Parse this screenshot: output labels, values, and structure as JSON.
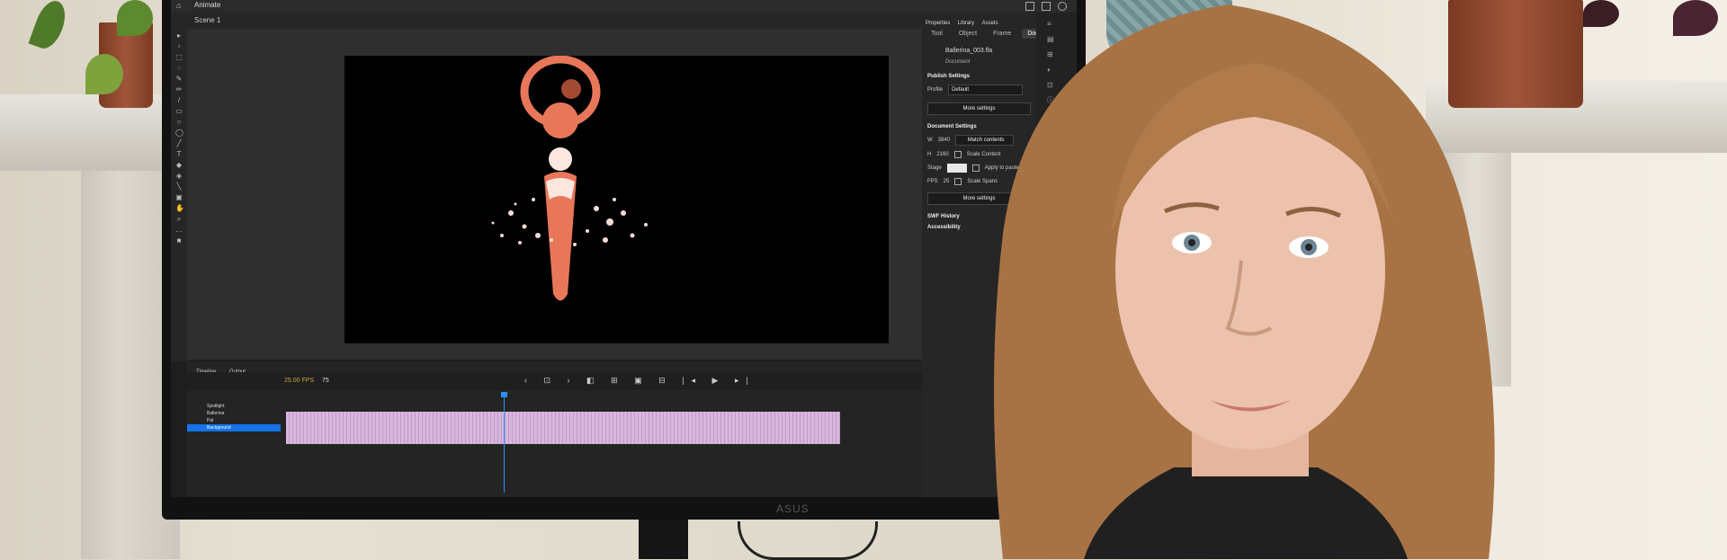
{
  "app": {
    "name": "Animate",
    "scene": "Scene 1"
  },
  "properties": {
    "tabs": [
      "Properties",
      "Library",
      "Assets"
    ],
    "subtabs": [
      "Tool",
      "Object",
      "Frame",
      "Doc"
    ],
    "file_name": "Ballerina_003.fla",
    "file_type": "Document",
    "publish_settings_title": "Publish Settings",
    "profile_label": "Profile",
    "profile_value": "Default",
    "more_settings_1": "More settings",
    "document_settings_title": "Document Settings",
    "width_label": "W",
    "width_value": "3840",
    "height_label": "H",
    "height_value": "2160",
    "match_contents": "Match contents",
    "scale_content": "Scale Content",
    "stage_label": "Stage",
    "apply_to_pasteboard": "Apply to pasteboard",
    "fps_label": "FPS",
    "fps_value": "25",
    "scale_spans": "Scale Spans",
    "more_settings_2": "More settings",
    "swf_history": "SWF History",
    "accessibility": "Accessibility"
  },
  "timeline": {
    "tabs": [
      "Timeline",
      "Output"
    ],
    "fps_display": "25.00 FPS",
    "current_frame": "75",
    "layers": [
      "Spotlight",
      "Ballerina",
      "Pal",
      "Background"
    ],
    "selected_layer": "Background"
  },
  "monitor": {
    "brand": "ASUS"
  }
}
